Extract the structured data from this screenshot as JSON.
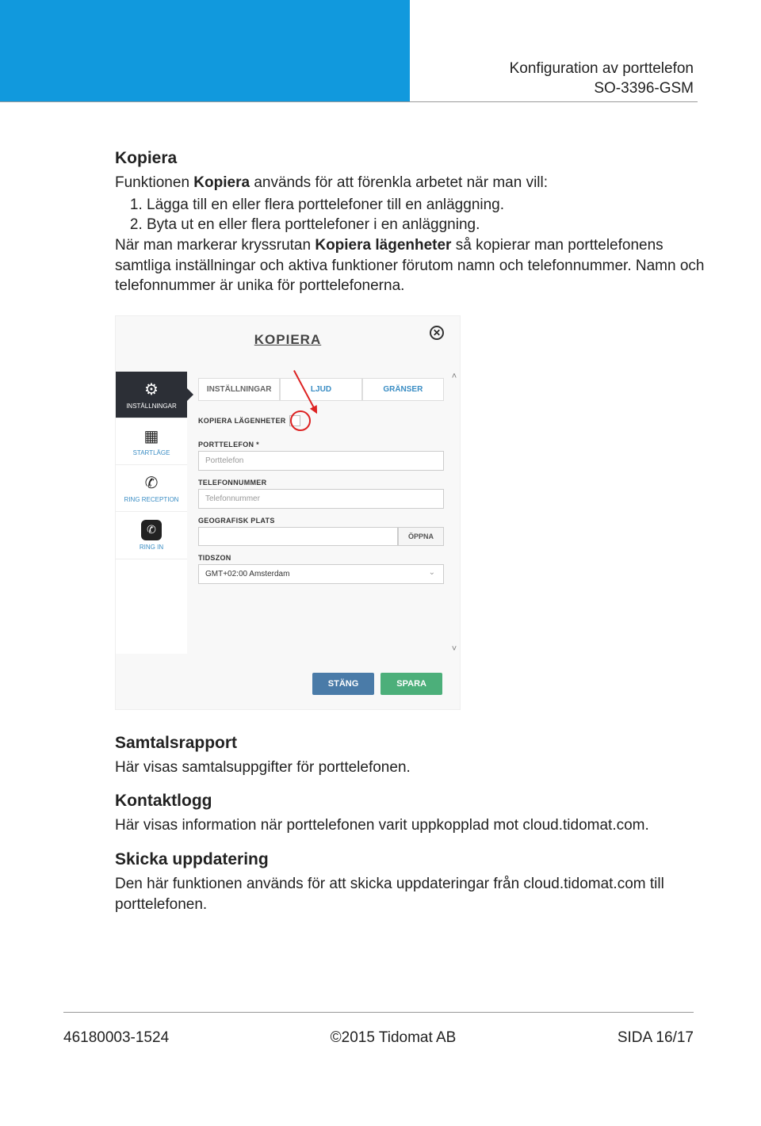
{
  "header": {
    "title": "Konfiguration av porttelefon",
    "model": "SO-3396-GSM"
  },
  "sections": {
    "kopiera": {
      "heading": "Kopiera",
      "intro_pre": "Funktionen ",
      "intro_bold": "Kopiera",
      "intro_post": " används för att förenkla arbetet när man vill:",
      "item1": "Lägga till en eller flera porttelefoner till en anläggning.",
      "item2": "Byta ut en eller flera porttelefoner i en anläggning.",
      "para2_pre": "När man markerar kryssrutan ",
      "para2_bold": "Kopiera lägenheter",
      "para2_post": " så kopierar man porttelefonens samtliga inställningar och aktiva funktioner förutom namn och telefonnummer. Namn och telefonnummer är unika för porttelefonerna."
    },
    "samtalsrapport": {
      "heading": "Samtalsrapport",
      "text": "Här visas samtalsuppgifter för porttelefonen."
    },
    "kontaktlogg": {
      "heading": "Kontaktlogg",
      "text": "Här visas information när porttelefonen varit uppkopplad mot cloud.tidomat.com."
    },
    "skicka": {
      "heading": "Skicka uppdatering",
      "text": "Den här funktionen används för att skicka uppdateringar från cloud.tidomat.com till porttelefonen."
    }
  },
  "screenshot": {
    "title": "KOPIERA",
    "nav": {
      "settings": "INSTÄLLNINGAR",
      "startlage": "STARTLÄGE",
      "reception": "RING RECEPTION",
      "ringin": "RING IN"
    },
    "tabs": {
      "settings": "INSTÄLLNINGAR",
      "ljud": "LJUD",
      "granser": "GRÄNSER"
    },
    "fields": {
      "kopiera_label": "KOPIERA LÄGENHETER",
      "port_label": "PORTTELEFON *",
      "port_placeholder": "Porttelefon",
      "tel_label": "TELEFONNUMMER",
      "tel_placeholder": "Telefonnummer",
      "geo_label": "GEOGRAFISK PLATS",
      "open_btn": "ÖPPNA",
      "tidszon_label": "TIDSZON",
      "tidszon_value": "GMT+02:00 Amsterdam"
    },
    "buttons": {
      "close": "STÄNG",
      "save": "SPARA"
    }
  },
  "footer": {
    "docnum": "46180003-1524",
    "copyright": "©2015 Tidomat AB",
    "page": "SIDA 16/17"
  }
}
